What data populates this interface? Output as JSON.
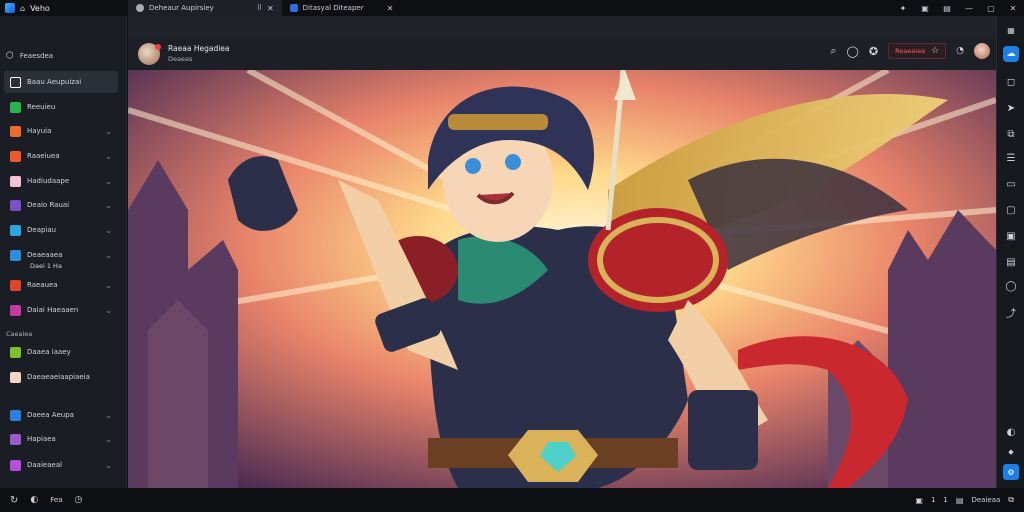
{
  "titlebar": {
    "app_title": "Veho",
    "tabs": [
      {
        "label": "Deheaur Aupirsiey",
        "active": true
      },
      {
        "label": "Ditasyal Diteaper",
        "active": false
      }
    ],
    "window_controls": [
      "—",
      "▢",
      "✕"
    ]
  },
  "sidebar": {
    "header": "Feaesdea",
    "items": [
      {
        "label": "Baau Aeupuizai",
        "selected": true,
        "color": "#ffffff"
      },
      {
        "label": "Reeuieu",
        "selected": false,
        "color": "#29b34a"
      },
      {
        "label": "Hayuia",
        "selected": false,
        "color": "#f06a2a"
      },
      {
        "label": "Raaeiuea",
        "selected": false,
        "color": "#f05a2a"
      },
      {
        "label": "Hadiudaape",
        "selected": false,
        "color": "#f2c2d6"
      },
      {
        "label": "Deaio Rauai",
        "selected": false,
        "color": "#7e4ec9"
      },
      {
        "label": "Deapiau",
        "selected": false,
        "color": "#2aa6e2"
      },
      {
        "label": "Deaeaaea",
        "selected": false,
        "color": "#2f8de0"
      },
      {
        "label": "Raeauea",
        "selected": false,
        "color": "#e0452b"
      },
      {
        "label": "Daiai Haeaaen",
        "selected": false,
        "color": "#c33aa0"
      }
    ],
    "sub_label": "Daei 1 Ha",
    "section_label": "Caeaiea",
    "section_items": [
      {
        "label": "Daaea iaaey",
        "color": "#7cc12a"
      },
      {
        "label": "Daeaeaeiaapiaeia",
        "color": "#f3d5c4"
      }
    ],
    "bottom_items": [
      {
        "label": "Daeea Aeupa",
        "color": "#2a7fe0"
      },
      {
        "label": "Hapiaea",
        "color": "#9b5ad0"
      },
      {
        "label": "Daaieaeal",
        "color": "#b44fd8"
      }
    ]
  },
  "conversation": {
    "title": "Raeaa Hegadiea",
    "subtitle": "Deaeas"
  },
  "header_tools": {
    "action_button": "Reaeaiea",
    "icons": [
      "search-icon",
      "chat-bubble-icon",
      "badge-icon",
      "star-icon",
      "clock-icon",
      "profile-avatar"
    ]
  },
  "status_bar": {
    "left_label": "Fea",
    "right_labels": [
      "1",
      "1",
      "Deaieaa"
    ]
  },
  "colors": {
    "accent_red": "#ff3b45",
    "rail_active": "#1e7fe6",
    "sidebar_bg": "#1a1d23"
  }
}
